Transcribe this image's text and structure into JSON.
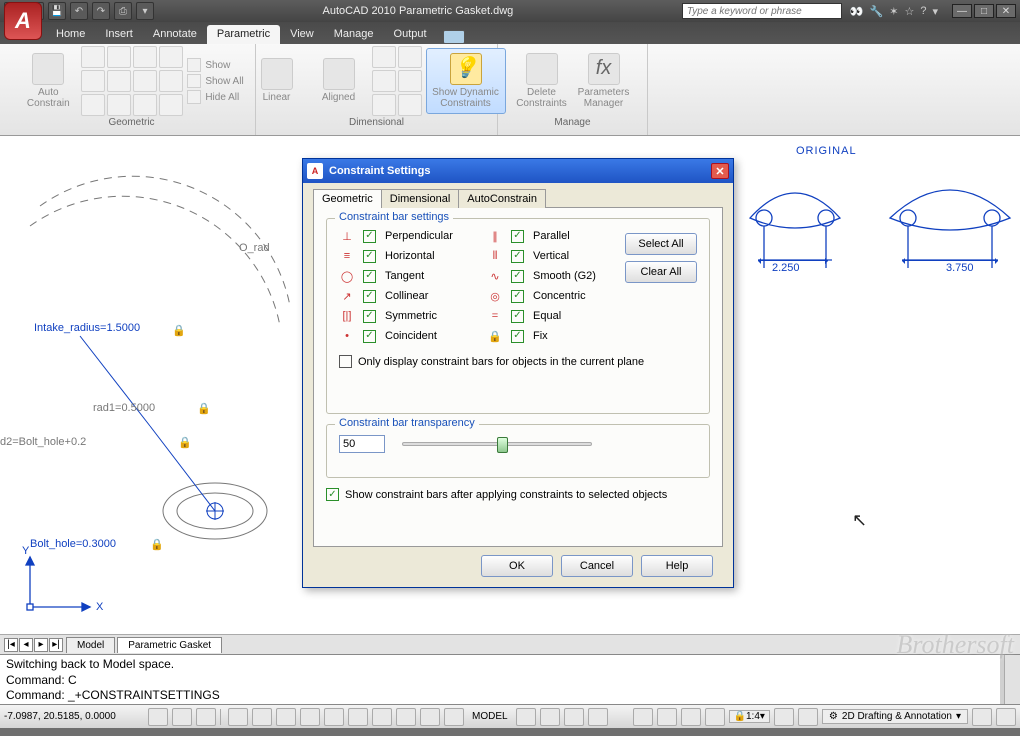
{
  "app": {
    "title": "AutoCAD 2010   Parametric Gasket.dwg",
    "logo": "A"
  },
  "search": {
    "placeholder": "Type a keyword or phrase"
  },
  "menu": [
    "Home",
    "Insert",
    "Annotate",
    "Parametric",
    "View",
    "Manage",
    "Output"
  ],
  "menu_active": 3,
  "ribbon": {
    "panels": [
      "Geometric",
      "Dimensional",
      "Manage"
    ],
    "auto": "Auto\nConstrain",
    "show": "Show",
    "showall": "Show All",
    "hideall": "Hide All",
    "linear": "Linear",
    "aligned": "Aligned",
    "showdyn": "Show Dynamic\nConstraints",
    "del": "Delete\nConstraints",
    "pmgr": "Parameters\nManager"
  },
  "canvas": {
    "original": "ORIGINAL",
    "intake": "Intake_radius=1.5000",
    "rad1": "rad1=0.5000",
    "d2": "d2=Bolt_hole+0.2",
    "bolt": "Bolt_hole=0.3000",
    "o_rad": "O_rad",
    "dim1": "2.250",
    "dim2": "3.750",
    "axX": "X",
    "axY": "Y"
  },
  "modeltabs": {
    "model": "Model",
    "layout": "Parametric Gasket"
  },
  "cmd": {
    "l1": "Switching back to Model space.",
    "l2": "Command: C",
    "l3": "Command: _+CONSTRAINTSETTINGS"
  },
  "status": {
    "coords": "-7.0987, 20.5185, 0.0000",
    "model": "MODEL",
    "scale": "1:4",
    "workspace": "2D Drafting & Annotation"
  },
  "dlg": {
    "title": "Constraint Settings",
    "tabs": [
      "Geometric",
      "Dimensional",
      "AutoConstrain"
    ],
    "grp1": "Constraint bar settings",
    "selectall": "Select All",
    "clearall": "Clear All",
    "c": [
      "Perpendicular",
      "Parallel",
      "Horizontal",
      "Vertical",
      "Tangent",
      "Smooth (G2)",
      "Collinear",
      "Concentric",
      "Symmetric",
      "Equal",
      "Coincident",
      "Fix"
    ],
    "only": "Only display constraint bars for objects in the current plane",
    "grp2": "Constraint bar transparency",
    "trans": "50",
    "showbars": "Show constraint bars after applying constraints to selected objects",
    "ok": "OK",
    "cancel": "Cancel",
    "help": "Help"
  },
  "watermark": "Brothersoft"
}
